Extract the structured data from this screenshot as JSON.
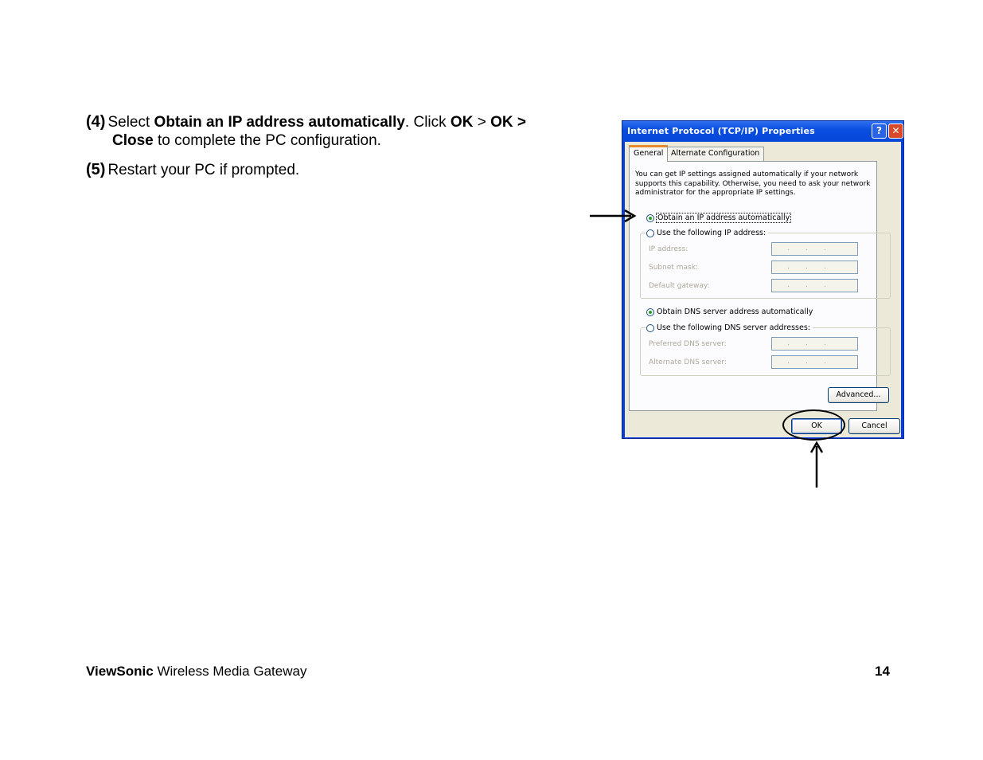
{
  "steps": [
    {
      "number": "(4)",
      "parts": [
        "Select ",
        "Obtain an IP address automatically",
        ". Click ",
        "OK",
        " > ",
        "OK >",
        "Close",
        " to complete the PC configuration."
      ]
    },
    {
      "number": "(5)",
      "text": "Restart your PC if prompted."
    }
  ],
  "dialog": {
    "title": "Internet Protocol (TCP/IP) Properties",
    "help_glyph": "?",
    "close_glyph": "✕",
    "tabs": [
      "General",
      "Alternate Configuration"
    ],
    "description": "You can get IP settings assigned automatically if your network supports this capability. Otherwise, you need to ask your network administrator for the appropriate IP settings.",
    "radio_obtain_ip": "Obtain an IP address automatically",
    "radio_use_ip": "Use the following IP address:",
    "ip_fields": [
      "IP address:",
      "Subnet mask:",
      "Default gateway:"
    ],
    "ip_dots": "...",
    "radio_obtain_dns": "Obtain DNS server address automatically",
    "radio_use_dns": "Use the following DNS server addresses:",
    "dns_fields": [
      "Preferred DNS server:",
      "Alternate DNS server:"
    ],
    "advanced_label": "Advanced...",
    "ok_label": "OK",
    "cancel_label": "Cancel",
    "selected": {
      "ip": "obtain",
      "dns": "obtain"
    }
  },
  "footer": {
    "brand": "ViewSonic",
    "product": " Wireless Media Gateway",
    "page": "14"
  }
}
